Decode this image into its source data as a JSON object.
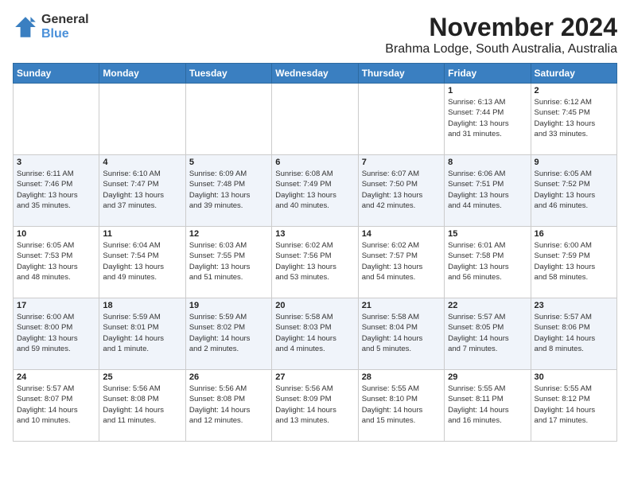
{
  "logo": {
    "general": "General",
    "blue": "Blue"
  },
  "title": {
    "month_year": "November 2024",
    "location": "Brahma Lodge, South Australia, Australia"
  },
  "days_of_week": [
    "Sunday",
    "Monday",
    "Tuesday",
    "Wednesday",
    "Thursday",
    "Friday",
    "Saturday"
  ],
  "weeks": [
    [
      {
        "day": "",
        "info": ""
      },
      {
        "day": "",
        "info": ""
      },
      {
        "day": "",
        "info": ""
      },
      {
        "day": "",
        "info": ""
      },
      {
        "day": "",
        "info": ""
      },
      {
        "day": "1",
        "info": "Sunrise: 6:13 AM\nSunset: 7:44 PM\nDaylight: 13 hours\nand 31 minutes."
      },
      {
        "day": "2",
        "info": "Sunrise: 6:12 AM\nSunset: 7:45 PM\nDaylight: 13 hours\nand 33 minutes."
      }
    ],
    [
      {
        "day": "3",
        "info": "Sunrise: 6:11 AM\nSunset: 7:46 PM\nDaylight: 13 hours\nand 35 minutes."
      },
      {
        "day": "4",
        "info": "Sunrise: 6:10 AM\nSunset: 7:47 PM\nDaylight: 13 hours\nand 37 minutes."
      },
      {
        "day": "5",
        "info": "Sunrise: 6:09 AM\nSunset: 7:48 PM\nDaylight: 13 hours\nand 39 minutes."
      },
      {
        "day": "6",
        "info": "Sunrise: 6:08 AM\nSunset: 7:49 PM\nDaylight: 13 hours\nand 40 minutes."
      },
      {
        "day": "7",
        "info": "Sunrise: 6:07 AM\nSunset: 7:50 PM\nDaylight: 13 hours\nand 42 minutes."
      },
      {
        "day": "8",
        "info": "Sunrise: 6:06 AM\nSunset: 7:51 PM\nDaylight: 13 hours\nand 44 minutes."
      },
      {
        "day": "9",
        "info": "Sunrise: 6:05 AM\nSunset: 7:52 PM\nDaylight: 13 hours\nand 46 minutes."
      }
    ],
    [
      {
        "day": "10",
        "info": "Sunrise: 6:05 AM\nSunset: 7:53 PM\nDaylight: 13 hours\nand 48 minutes."
      },
      {
        "day": "11",
        "info": "Sunrise: 6:04 AM\nSunset: 7:54 PM\nDaylight: 13 hours\nand 49 minutes."
      },
      {
        "day": "12",
        "info": "Sunrise: 6:03 AM\nSunset: 7:55 PM\nDaylight: 13 hours\nand 51 minutes."
      },
      {
        "day": "13",
        "info": "Sunrise: 6:02 AM\nSunset: 7:56 PM\nDaylight: 13 hours\nand 53 minutes."
      },
      {
        "day": "14",
        "info": "Sunrise: 6:02 AM\nSunset: 7:57 PM\nDaylight: 13 hours\nand 54 minutes."
      },
      {
        "day": "15",
        "info": "Sunrise: 6:01 AM\nSunset: 7:58 PM\nDaylight: 13 hours\nand 56 minutes."
      },
      {
        "day": "16",
        "info": "Sunrise: 6:00 AM\nSunset: 7:59 PM\nDaylight: 13 hours\nand 58 minutes."
      }
    ],
    [
      {
        "day": "17",
        "info": "Sunrise: 6:00 AM\nSunset: 8:00 PM\nDaylight: 13 hours\nand 59 minutes."
      },
      {
        "day": "18",
        "info": "Sunrise: 5:59 AM\nSunset: 8:01 PM\nDaylight: 14 hours\nand 1 minute."
      },
      {
        "day": "19",
        "info": "Sunrise: 5:59 AM\nSunset: 8:02 PM\nDaylight: 14 hours\nand 2 minutes."
      },
      {
        "day": "20",
        "info": "Sunrise: 5:58 AM\nSunset: 8:03 PM\nDaylight: 14 hours\nand 4 minutes."
      },
      {
        "day": "21",
        "info": "Sunrise: 5:58 AM\nSunset: 8:04 PM\nDaylight: 14 hours\nand 5 minutes."
      },
      {
        "day": "22",
        "info": "Sunrise: 5:57 AM\nSunset: 8:05 PM\nDaylight: 14 hours\nand 7 minutes."
      },
      {
        "day": "23",
        "info": "Sunrise: 5:57 AM\nSunset: 8:06 PM\nDaylight: 14 hours\nand 8 minutes."
      }
    ],
    [
      {
        "day": "24",
        "info": "Sunrise: 5:57 AM\nSunset: 8:07 PM\nDaylight: 14 hours\nand 10 minutes."
      },
      {
        "day": "25",
        "info": "Sunrise: 5:56 AM\nSunset: 8:08 PM\nDaylight: 14 hours\nand 11 minutes."
      },
      {
        "day": "26",
        "info": "Sunrise: 5:56 AM\nSunset: 8:08 PM\nDaylight: 14 hours\nand 12 minutes."
      },
      {
        "day": "27",
        "info": "Sunrise: 5:56 AM\nSunset: 8:09 PM\nDaylight: 14 hours\nand 13 minutes."
      },
      {
        "day": "28",
        "info": "Sunrise: 5:55 AM\nSunset: 8:10 PM\nDaylight: 14 hours\nand 15 minutes."
      },
      {
        "day": "29",
        "info": "Sunrise: 5:55 AM\nSunset: 8:11 PM\nDaylight: 14 hours\nand 16 minutes."
      },
      {
        "day": "30",
        "info": "Sunrise: 5:55 AM\nSunset: 8:12 PM\nDaylight: 14 hours\nand 17 minutes."
      }
    ]
  ]
}
